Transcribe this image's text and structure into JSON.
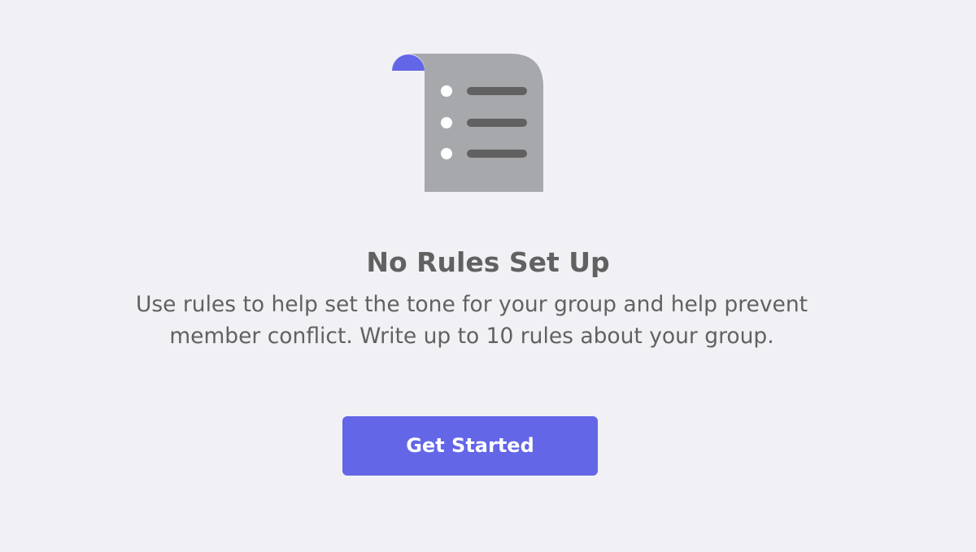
{
  "empty_state": {
    "title": "No Rules Set Up",
    "description": "Use rules to help set the tone for your group and help prevent member conflict. Write up to 10 rules about your group.",
    "button_label": "Get Started"
  },
  "illustration": {
    "icon": "rules-document-icon",
    "bullet_count": 3
  },
  "colors": {
    "background": "#f1f1f5",
    "accent": "#6366e6",
    "document": "#a7a8ac",
    "document_lines": "#616161",
    "text": "#616161"
  }
}
